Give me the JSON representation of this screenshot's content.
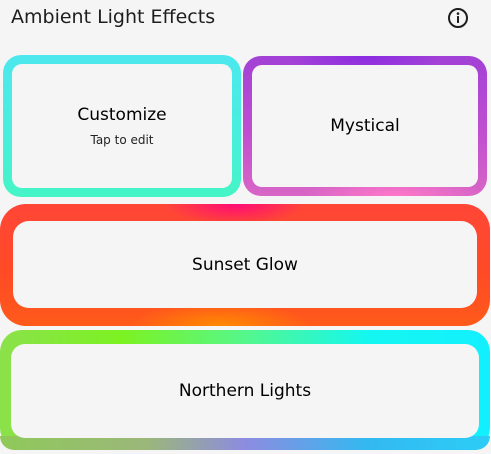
{
  "header": {
    "title": "Ambient Light Effects",
    "info_icon": "info-icon"
  },
  "cards": [
    {
      "title": "Customize",
      "subtitle": "Tap to edit",
      "colors": [
        "#4de8ee",
        "#45f5c6"
      ]
    },
    {
      "title": "Mystical",
      "colors": [
        "#8a2be2",
        "#c04fd0",
        "#ff77c8"
      ]
    },
    {
      "title": "Sunset Glow",
      "colors": [
        "#ff4637",
        "#ff0a78",
        "#ff8a00"
      ]
    },
    {
      "title": "Northern Lights",
      "colors": [
        "#7cf222",
        "#14f7f0",
        "#9b7be6",
        "#2ccdf6"
      ]
    }
  ]
}
